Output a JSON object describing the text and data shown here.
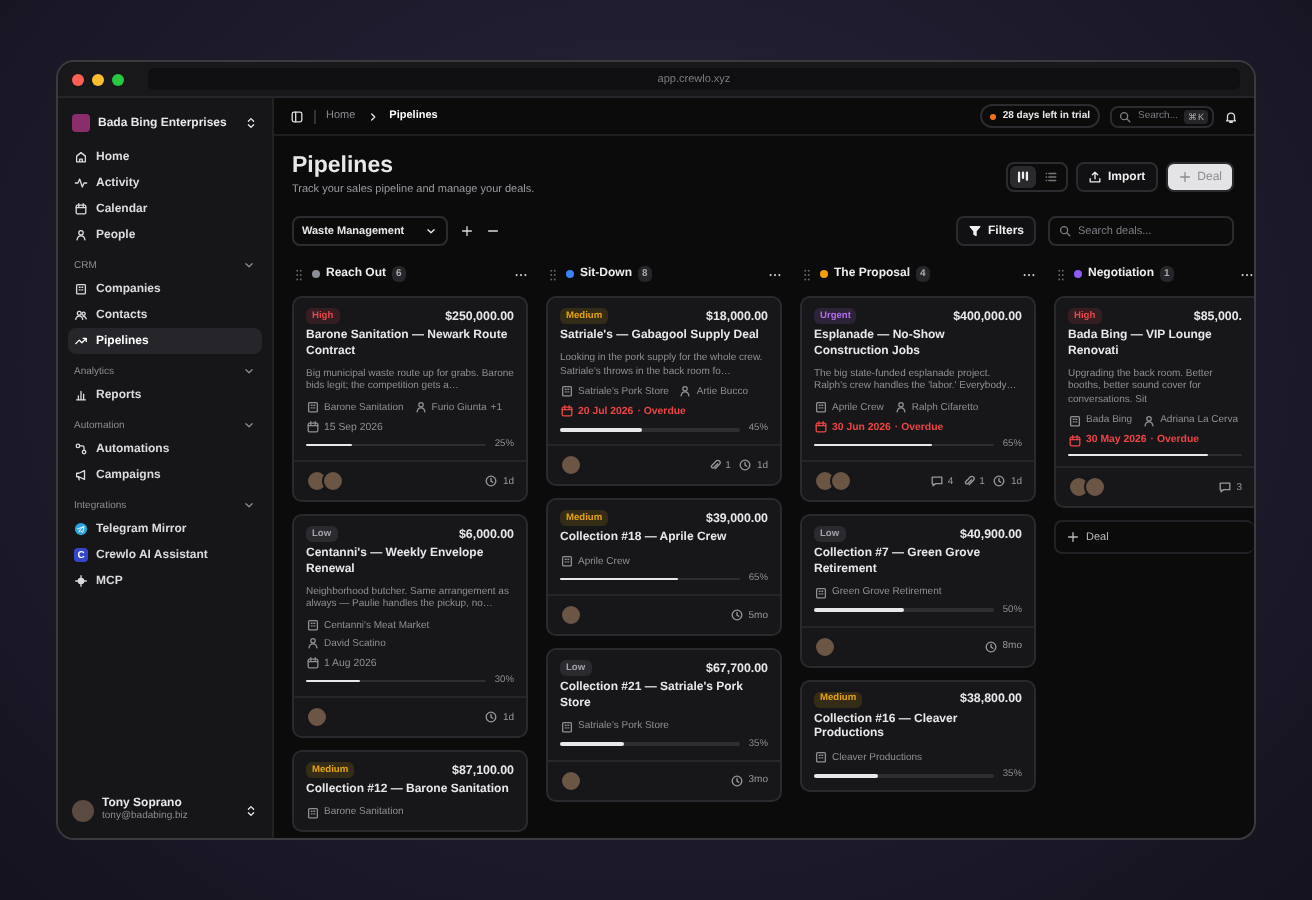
{
  "window": {
    "url": "app.crewlo.xyz"
  },
  "sidebar": {
    "workspace": "Bada Bing Enterprises",
    "sections": [
      {
        "items": [
          {
            "label": "Home",
            "selected": false
          },
          {
            "label": "Activity",
            "selected": false
          },
          {
            "label": "Calendar",
            "selected": false
          },
          {
            "label": "People",
            "selected": false
          }
        ]
      },
      {
        "title": "CRM",
        "expanded": true,
        "items": [
          {
            "label": "Companies",
            "selected": false
          },
          {
            "label": "Contacts",
            "selected": false
          },
          {
            "label": "Pipelines",
            "selected": true
          }
        ]
      },
      {
        "title": "Analytics",
        "expanded": true,
        "items": [
          {
            "label": "Reports",
            "selected": false
          }
        ]
      },
      {
        "title": "Automation",
        "expanded": true,
        "items": [
          {
            "label": "Automations",
            "selected": false
          },
          {
            "label": "Campaigns",
            "selected": false
          }
        ]
      },
      {
        "title": "Integrations",
        "expanded": true,
        "items": [
          {
            "label": "Telegram Mirror",
            "selected": false
          },
          {
            "label": "Crewlo AI Assistant",
            "selected": false,
            "icon_text": "C"
          },
          {
            "label": "MCP",
            "selected": false
          }
        ]
      }
    ],
    "user": {
      "name": "Tony Soprano",
      "email": "tony@badabing.biz"
    }
  },
  "topbar": {
    "breadcrumb": [
      "Home",
      "Pipelines"
    ],
    "trial": "28 days left in trial",
    "search": {
      "placeholder": "Search...",
      "shortcut": "⌘K"
    }
  },
  "header": {
    "title": "Pipelines",
    "subtitle": "Track your sales pipeline and manage your deals.",
    "views": [
      {
        "selected": true
      },
      {
        "selected": false
      }
    ],
    "import": "Import",
    "add": "Deal"
  },
  "toolbar": {
    "pipeline": "Waste Management",
    "filters": "Filters",
    "search": {
      "placeholder": "Search deals..."
    }
  },
  "columns": [
    {
      "name": "Reach Out",
      "count": "6",
      "color": "#8b8f98",
      "cards": [
        {
          "priority": {
            "label": "High",
            "kind": "high"
          },
          "amount": "$250,000.00",
          "title": "Barone Sanitation — Newark Route Contract",
          "description": "Big municipal waste route up for grabs. Barone bids legit; the competition gets a…",
          "company": "Barone Sanitation",
          "contact": "Furio Giunta",
          "contact_extra": "+1",
          "date": "15 Sep 2026",
          "overdue": false,
          "progress": {
            "level": 0.25,
            "reading": "25%"
          },
          "avatars": [
            {
              "kind": "photo"
            },
            {
              "kind": "photo"
            }
          ],
          "age": "1d"
        },
        {
          "priority": {
            "label": "Low",
            "kind": "low"
          },
          "amount": "$6,000.00",
          "title": "Centanni's — Weekly Envelope Renewal",
          "description": "Neighborhood butcher. Same arrangement as always — Paulie handles the pickup, no…",
          "company": "Centanni's Meat Market",
          "contact": "David Scatino",
          "date": "1 Aug 2026",
          "overdue": false,
          "progress": {
            "level": 0.3,
            "reading": "30%"
          },
          "avatars": [
            {
              "kind": "photo"
            }
          ],
          "age": "1d"
        },
        {
          "priority": {
            "label": "Medium",
            "kind": "medium"
          },
          "amount": "$87,100.00",
          "title": "Collection #12 — Barone Sanitation",
          "company": "Barone Sanitation"
        }
      ]
    },
    {
      "name": "Sit-Down",
      "count": "8",
      "color": "#3b82f6",
      "cards": [
        {
          "priority": {
            "label": "Medium",
            "kind": "medium"
          },
          "amount": "$18,000.00",
          "title": "Satriale's — Gabagool Supply Deal",
          "description": "Looking in the pork supply for the whole crew. Satriale's throws in the back room fo…",
          "company": "Satriale's Pork Store",
          "contact": "Artie Bucco",
          "date": "20 Jul 2026",
          "overdue": true,
          "overdue_label": "· Overdue",
          "progress": {
            "level": 0.45,
            "reading": "45%"
          },
          "avatars": [
            {
              "kind": "photo"
            }
          ],
          "attachments": "1",
          "age": "1d"
        },
        {
          "priority": {
            "label": "Medium",
            "kind": "medium"
          },
          "amount": "$39,000.00",
          "title": "Collection #18 — Aprile Crew",
          "company": "Aprile Crew",
          "progress": {
            "level": 0.65,
            "reading": "65%"
          },
          "avatars": [
            {
              "kind": "photo"
            }
          ],
          "age": "5mo"
        },
        {
          "priority": {
            "label": "Low",
            "kind": "low"
          },
          "amount": "$67,700.00",
          "title": "Collection #21 — Satriale's Pork Store",
          "company": "Satriale's Pork Store",
          "progress": {
            "level": 0.35,
            "reading": "35%"
          },
          "avatars": [
            {
              "kind": "photo"
            }
          ],
          "age": "3mo"
        }
      ]
    },
    {
      "name": "The Proposal",
      "count": "4",
      "color": "#f59e0b",
      "cards": [
        {
          "priority": {
            "label": "Urgent",
            "kind": "urgent"
          },
          "amount": "$400,000.00",
          "title": "Esplanade — No-Show Construction Jobs",
          "description": "The big state-funded esplanade project. Ralph's crew handles the 'labor.' Everybody…",
          "company": "Aprile Crew",
          "contact": "Ralph Cifaretto",
          "date": "30 Jun 2026",
          "overdue": true,
          "overdue_label": "· Overdue",
          "progress": {
            "level": 0.65,
            "reading": "65%"
          },
          "avatars": [
            {
              "kind": "photo"
            },
            {
              "kind": "photo"
            }
          ],
          "comments": "4",
          "attachments": "1",
          "age": "1d"
        },
        {
          "priority": {
            "label": "Low",
            "kind": "low"
          },
          "amount": "$40,900.00",
          "title": "Collection #7 — Green Grove Retirement",
          "company": "Green Grove Retirement",
          "progress": {
            "level": 0.5,
            "reading": "50%"
          },
          "avatars": [
            {
              "kind": "photo"
            }
          ],
          "age": "8mo"
        },
        {
          "priority": {
            "label": "Medium",
            "kind": "medium"
          },
          "amount": "$38,800.00",
          "title": "Collection #16 — Cleaver Productions",
          "company": "Cleaver Productions",
          "progress": {
            "level": 0.35,
            "reading": "35%"
          }
        }
      ]
    },
    {
      "name": "Negotiation",
      "count": "1",
      "color": "#8b5cf6",
      "add_button": "Deal",
      "cards": [
        {
          "priority": {
            "label": "High",
            "kind": "high"
          },
          "amount": "$85,000.",
          "title": "Bada Bing — VIP Lounge Renovati",
          "description": "Upgrading the back room. Better booths, better sound cover for conversations. Sit",
          "company": "Bada Bing",
          "contact": "Adriana La Cerva",
          "date": "30 May 2026",
          "overdue": true,
          "overdue_label": "· Overdue",
          "progress": {
            "level": 0.8
          },
          "avatars": [
            {
              "kind": "photo"
            },
            {
              "kind": "photo"
            }
          ],
          "comments": "3"
        }
      ]
    }
  ]
}
